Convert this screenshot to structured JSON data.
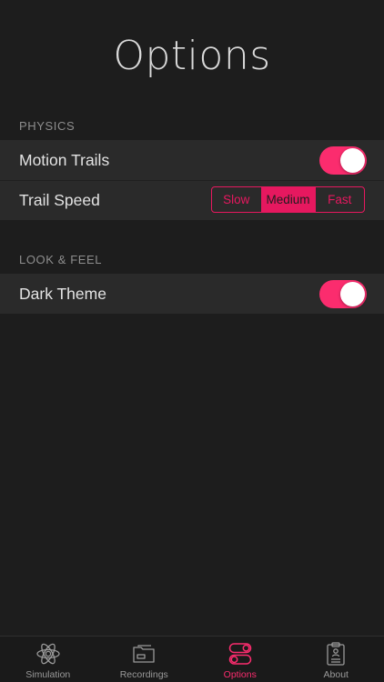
{
  "title": "Options",
  "colors": {
    "accent": "#fb2c6e",
    "background": "#1d1d1d",
    "row_background": "#2a2a2a"
  },
  "sections": {
    "physics": {
      "header": "PHYSICS",
      "motion_trails": {
        "label": "Motion Trails",
        "enabled": true
      },
      "trail_speed": {
        "label": "Trail Speed",
        "options": [
          "Slow",
          "Medium",
          "Fast"
        ],
        "selected": "Medium"
      }
    },
    "look": {
      "header": "LOOK & FEEL",
      "dark_theme": {
        "label": "Dark Theme",
        "enabled": true
      }
    }
  },
  "tabbar": {
    "items": [
      {
        "label": "Simulation",
        "icon": "atom-icon",
        "active": false
      },
      {
        "label": "Recordings",
        "icon": "folder-icon",
        "active": false
      },
      {
        "label": "Options",
        "icon": "toggles-icon",
        "active": true
      },
      {
        "label": "About",
        "icon": "clipboard-icon",
        "active": false
      }
    ]
  }
}
